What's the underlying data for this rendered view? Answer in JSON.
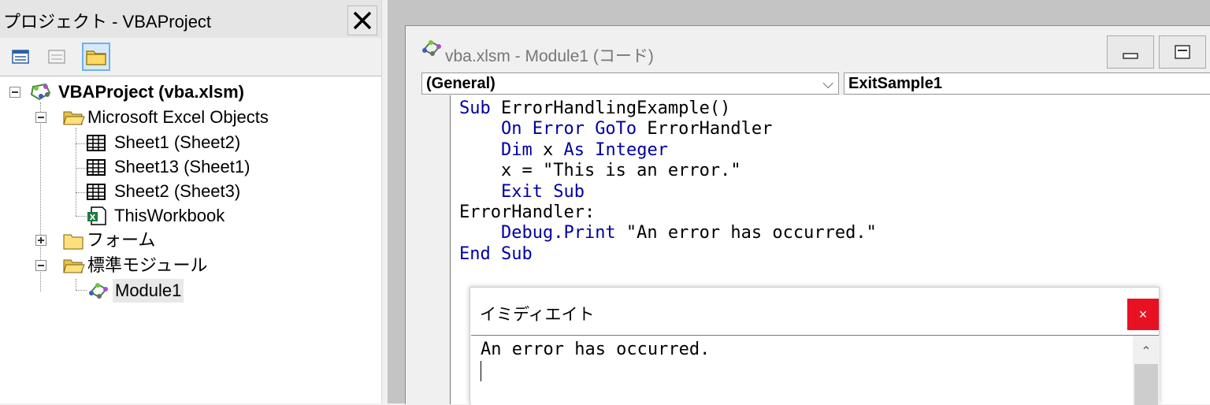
{
  "project_explorer": {
    "title": "プロジェクト - VBAProject",
    "close_glyph": "X",
    "tree": {
      "root": "VBAProject (vba.xlsm)",
      "folder_excel_objects": "Microsoft Excel Objects",
      "sheets": [
        "Sheet1 (Sheet2)",
        "Sheet13 (Sheet1)",
        "Sheet2 (Sheet3)"
      ],
      "workbook": "ThisWorkbook",
      "folder_forms": "フォーム",
      "folder_modules": "標準モジュール",
      "module": "Module1"
    }
  },
  "code_window": {
    "title": "vba.xlsm - Module1 (コード)",
    "object_combo": "(General)",
    "procedure_combo": "ExitSample1",
    "code": [
      [
        {
          "t": "Sub",
          "k": true
        },
        {
          "t": " ErrorHandlingExample()"
        }
      ],
      [
        {
          "t": "    "
        },
        {
          "t": "On Error GoTo",
          "k": true
        },
        {
          "t": " ErrorHandler"
        }
      ],
      [
        {
          "t": "    "
        },
        {
          "t": "Dim",
          "k": true
        },
        {
          "t": " x "
        },
        {
          "t": "As Integer",
          "k": true
        }
      ],
      [
        {
          "t": "    x = \"This is an error.\""
        }
      ],
      [
        {
          "t": "    "
        },
        {
          "t": "Exit Sub",
          "k": true
        }
      ],
      [
        {
          "t": "ErrorHandler:"
        }
      ],
      [
        {
          "t": "    "
        },
        {
          "t": "Debug.Print",
          "k": true
        },
        {
          "t": " \"An error has occurred.\""
        }
      ],
      [
        {
          "t": "End Sub",
          "k": true
        }
      ]
    ]
  },
  "immediate_window": {
    "title": "イミディエイト",
    "close_glyph": "×",
    "output": "An error has occurred."
  },
  "colors": {
    "keyword": "#0000a0",
    "close_red": "#e81123"
  }
}
